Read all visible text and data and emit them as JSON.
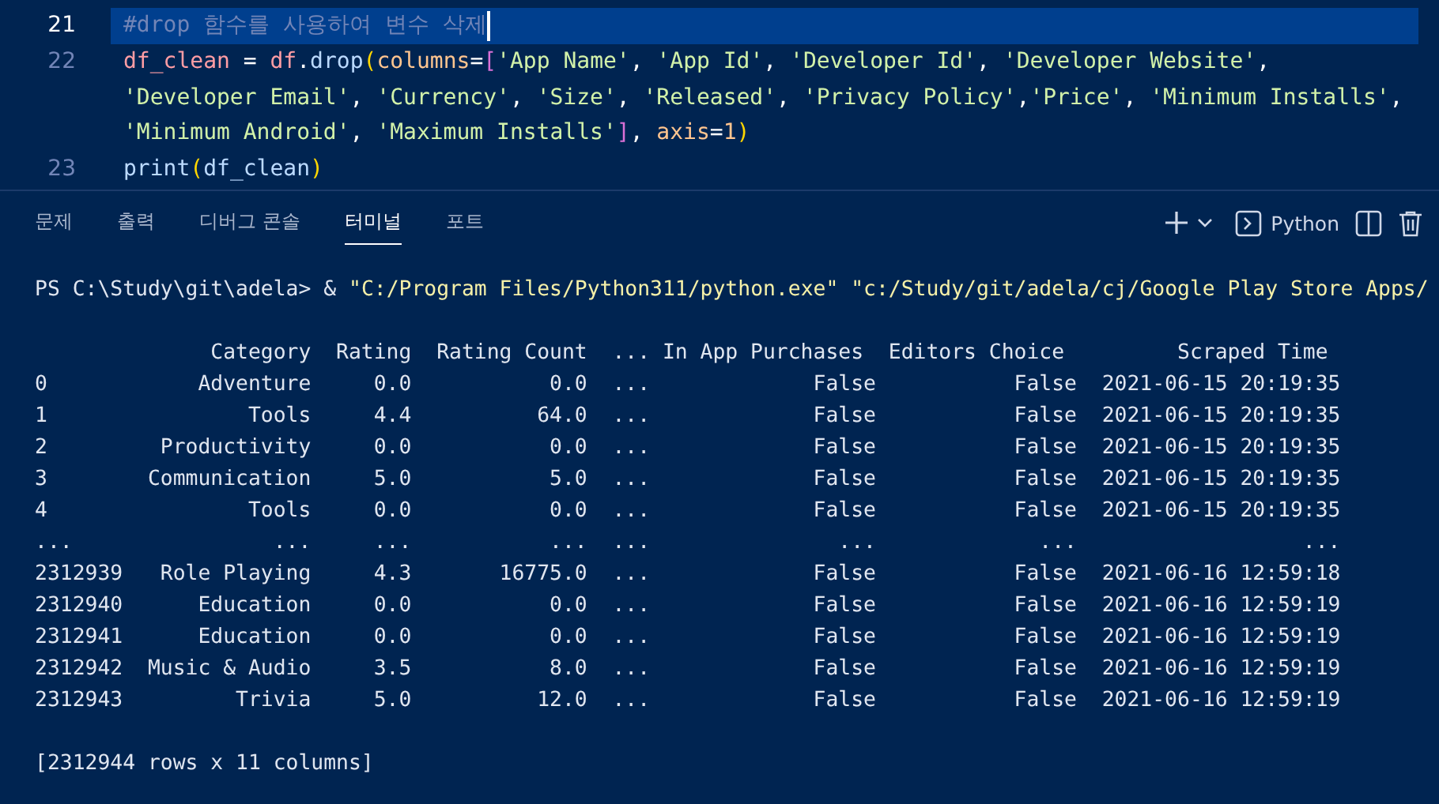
{
  "editor": {
    "lines": [
      {
        "number": "21",
        "current": true,
        "rows": [
          {
            "segments": [
              {
                "kind": "comment",
                "text": "#drop 함수를 사용하여 변수 삭제"
              }
            ]
          }
        ]
      },
      {
        "number": "22",
        "current": false,
        "rows": [
          {
            "segments": [
              {
                "kind": "variable",
                "text": "df_clean"
              },
              {
                "kind": "punct",
                "text": " = "
              },
              {
                "kind": "variable",
                "text": "df"
              },
              {
                "kind": "punct",
                "text": "."
              },
              {
                "kind": "function",
                "text": "drop"
              },
              {
                "kind": "paren",
                "text": "("
              },
              {
                "kind": "param",
                "text": "columns"
              },
              {
                "kind": "punct",
                "text": "="
              },
              {
                "kind": "bracket",
                "text": "["
              },
              {
                "kind": "string",
                "text": "'App Name'"
              },
              {
                "kind": "punct",
                "text": ", "
              },
              {
                "kind": "string",
                "text": "'App Id'"
              },
              {
                "kind": "punct",
                "text": ", "
              },
              {
                "kind": "string",
                "text": "'Developer Id'"
              },
              {
                "kind": "punct",
                "text": ", "
              },
              {
                "kind": "string",
                "text": "'Developer Website'"
              },
              {
                "kind": "punct",
                "text": ","
              }
            ]
          },
          {
            "segments": [
              {
                "kind": "string",
                "text": "'Developer Email'"
              },
              {
                "kind": "punct",
                "text": ", "
              },
              {
                "kind": "string",
                "text": "'Currency'"
              },
              {
                "kind": "punct",
                "text": ", "
              },
              {
                "kind": "string",
                "text": "'Size'"
              },
              {
                "kind": "punct",
                "text": ", "
              },
              {
                "kind": "string",
                "text": "'Released'"
              },
              {
                "kind": "punct",
                "text": ", "
              },
              {
                "kind": "string",
                "text": "'Privacy Policy'"
              },
              {
                "kind": "punct",
                "text": ","
              },
              {
                "kind": "string",
                "text": "'Price'"
              },
              {
                "kind": "punct",
                "text": ", "
              },
              {
                "kind": "string",
                "text": "'Minimum Installs'"
              },
              {
                "kind": "punct",
                "text": ","
              }
            ]
          },
          {
            "segments": [
              {
                "kind": "string",
                "text": "'Minimum Android'"
              },
              {
                "kind": "punct",
                "text": ", "
              },
              {
                "kind": "string",
                "text": "'Maximum Installs'"
              },
              {
                "kind": "bracket",
                "text": "]"
              },
              {
                "kind": "punct",
                "text": ", "
              },
              {
                "kind": "param",
                "text": "axis"
              },
              {
                "kind": "punct",
                "text": "="
              },
              {
                "kind": "number",
                "text": "1"
              },
              {
                "kind": "paren",
                "text": ")"
              }
            ]
          }
        ]
      },
      {
        "number": "23",
        "current": false,
        "rows": [
          {
            "segments": [
              {
                "kind": "function",
                "text": "print"
              },
              {
                "kind": "paren",
                "text": "("
              },
              {
                "kind": "plain",
                "text": "df_clean"
              },
              {
                "kind": "paren",
                "text": ")"
              }
            ]
          }
        ]
      }
    ]
  },
  "panel": {
    "tabs": [
      {
        "label": "문제",
        "selected": false
      },
      {
        "label": "출력",
        "selected": false
      },
      {
        "label": "디버그 콘솔",
        "selected": false
      },
      {
        "label": "터미널",
        "selected": true
      },
      {
        "label": "포트",
        "selected": false
      }
    ],
    "profile": "Python"
  },
  "terminal": {
    "blocks": [
      [
        {
          "segments": [
            {
              "kind": "plain",
              "text": "PS C:\\Study\\git\\adela> & "
            },
            {
              "kind": "string",
              "text": "\"C:/Program Files/Python311/python.exe\" "
            },
            {
              "kind": "string",
              "text": "\"c:/Study/git/adela/cj/Google Play Store Apps/"
            }
          ]
        }
      ],
      [
        {
          "segments": [
            {
              "kind": "plain",
              "text": "              Category  Rating  Rating Count  ... In App Purchases  Editors Choice         Scraped Time"
            }
          ]
        },
        {
          "segments": [
            {
              "kind": "plain",
              "text": "0            Adventure     0.0           0.0  ...             False           False  2021-06-15 20:19:35"
            }
          ]
        },
        {
          "segments": [
            {
              "kind": "plain",
              "text": "1                Tools     4.4          64.0  ...             False           False  2021-06-15 20:19:35"
            }
          ]
        },
        {
          "segments": [
            {
              "kind": "plain",
              "text": "2         Productivity     0.0           0.0  ...             False           False  2021-06-15 20:19:35"
            }
          ]
        },
        {
          "segments": [
            {
              "kind": "plain",
              "text": "3        Communication     5.0           5.0  ...             False           False  2021-06-15 20:19:35"
            }
          ]
        },
        {
          "segments": [
            {
              "kind": "plain",
              "text": "4                Tools     0.0           0.0  ...             False           False  2021-06-15 20:19:35"
            }
          ]
        },
        {
          "segments": [
            {
              "kind": "plain",
              "text": "...                ...     ...           ...  ...               ...             ...                  ..."
            }
          ]
        },
        {
          "segments": [
            {
              "kind": "plain",
              "text": "2312939   Role Playing     4.3       16775.0  ...             False           False  2021-06-16 12:59:18"
            }
          ]
        },
        {
          "segments": [
            {
              "kind": "plain",
              "text": "2312940      Education     0.0           0.0  ...             False           False  2021-06-16 12:59:19"
            }
          ]
        },
        {
          "segments": [
            {
              "kind": "plain",
              "text": "2312941      Education     0.0           0.0  ...             False           False  2021-06-16 12:59:19"
            }
          ]
        },
        {
          "segments": [
            {
              "kind": "plain",
              "text": "2312942  Music & Audio     3.5           8.0  ...             False           False  2021-06-16 12:59:19"
            }
          ]
        },
        {
          "segments": [
            {
              "kind": "plain",
              "text": "2312943         Trivia     5.0          12.0  ...             False           False  2021-06-16 12:59:19"
            }
          ]
        }
      ],
      [
        {
          "segments": [
            {
              "kind": "plain",
              "text": "[2312944 rows x 11 columns]"
            }
          ]
        }
      ]
    ]
  }
}
